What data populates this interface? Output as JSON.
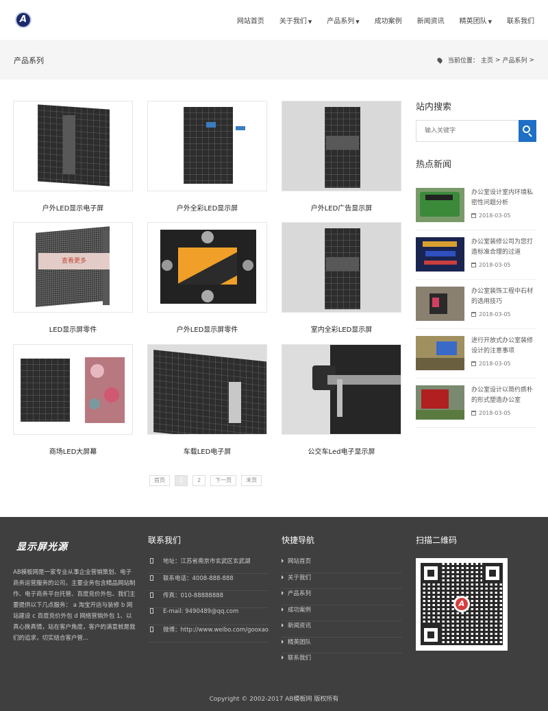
{
  "header": {
    "logo_letter": "A",
    "nav": [
      {
        "label": "网站首页",
        "dropdown": false
      },
      {
        "label": "关于我们",
        "dropdown": true
      },
      {
        "label": "产品系列",
        "dropdown": true
      },
      {
        "label": "成功案例",
        "dropdown": false
      },
      {
        "label": "新闻资讯",
        "dropdown": false
      },
      {
        "label": "精英团队",
        "dropdown": true
      },
      {
        "label": "联系我们",
        "dropdown": false
      }
    ]
  },
  "titlebar": {
    "title": "产品系列",
    "crumb_prefix": "当前位置：",
    "crumb_home": "主页",
    "crumb_sep": ">",
    "crumb_current": "产品系列",
    "crumb_end": ">"
  },
  "products": [
    {
      "name": "户外LED显示电子屏"
    },
    {
      "name": "户外全彩LED显示屏"
    },
    {
      "name": "户外LED广告显示屏"
    },
    {
      "name": "LED显示屏零件",
      "overlay": "查看更多"
    },
    {
      "name": "户外LED显示屏零件"
    },
    {
      "name": "室内全彩LED显示屏"
    },
    {
      "name": "商场LED大屏幕"
    },
    {
      "name": "车载LED电子屏"
    },
    {
      "name": "公交车Led电子显示屏"
    }
  ],
  "pagination": {
    "first": "首页",
    "pages": [
      "1",
      "2"
    ],
    "active": "1",
    "next": "下一页",
    "last": "末页"
  },
  "sidebar": {
    "search_title": "站内搜索",
    "search_placeholder": "输入关键字",
    "news_title": "热点新闻",
    "news": [
      {
        "title": "办公室设计室内环境私密性问题分析",
        "date": "2018-03-05"
      },
      {
        "title": "办公室装修公司为您打造标准合理的过道",
        "date": "2018-03-05"
      },
      {
        "title": "办公室装饰工程中石材的选用技巧",
        "date": "2018-03-05"
      },
      {
        "title": "进行开放式办公室装修设计的注意事项",
        "date": "2018-03-05"
      },
      {
        "title": "办公室设计以简约质朴的形式塑造办公室",
        "date": "2018-03-05"
      }
    ]
  },
  "footer": {
    "logo_text": "显示屏光源",
    "about": "AB模板网是一家专业从事企业营销策划、电子商务运营服务的公司，主要业务包含精品网站制作、电子商务平台托管、百度竞价外包、我们主要提供以下几点服务： a 淘宝开店与装修 b 网站建设 c 百度竞价外包 d 网络营销外包 1、以真心换真情，站在客户角度，客户的满意就是我们的追求，切实结合客户管...",
    "contact_title": "联系我们",
    "contact": [
      "地址：江苏省南京市玄武区玄武湖",
      "联系电话：4008-888-888",
      "传真：010-88888888",
      "E-mail: 9490489@qq.com",
      "微博：http://www.weibo.com/gooxao"
    ],
    "nav_title": "快捷导航",
    "nav": [
      "网站首页",
      "关于我们",
      "产品系列",
      "成功案例",
      "新闻资讯",
      "精英团队",
      "联系我们"
    ],
    "qr_title": "扫描二维码",
    "qr_logo": "A",
    "copyright": "Copyright © 2002-2017 AB模板网 版权所有"
  }
}
